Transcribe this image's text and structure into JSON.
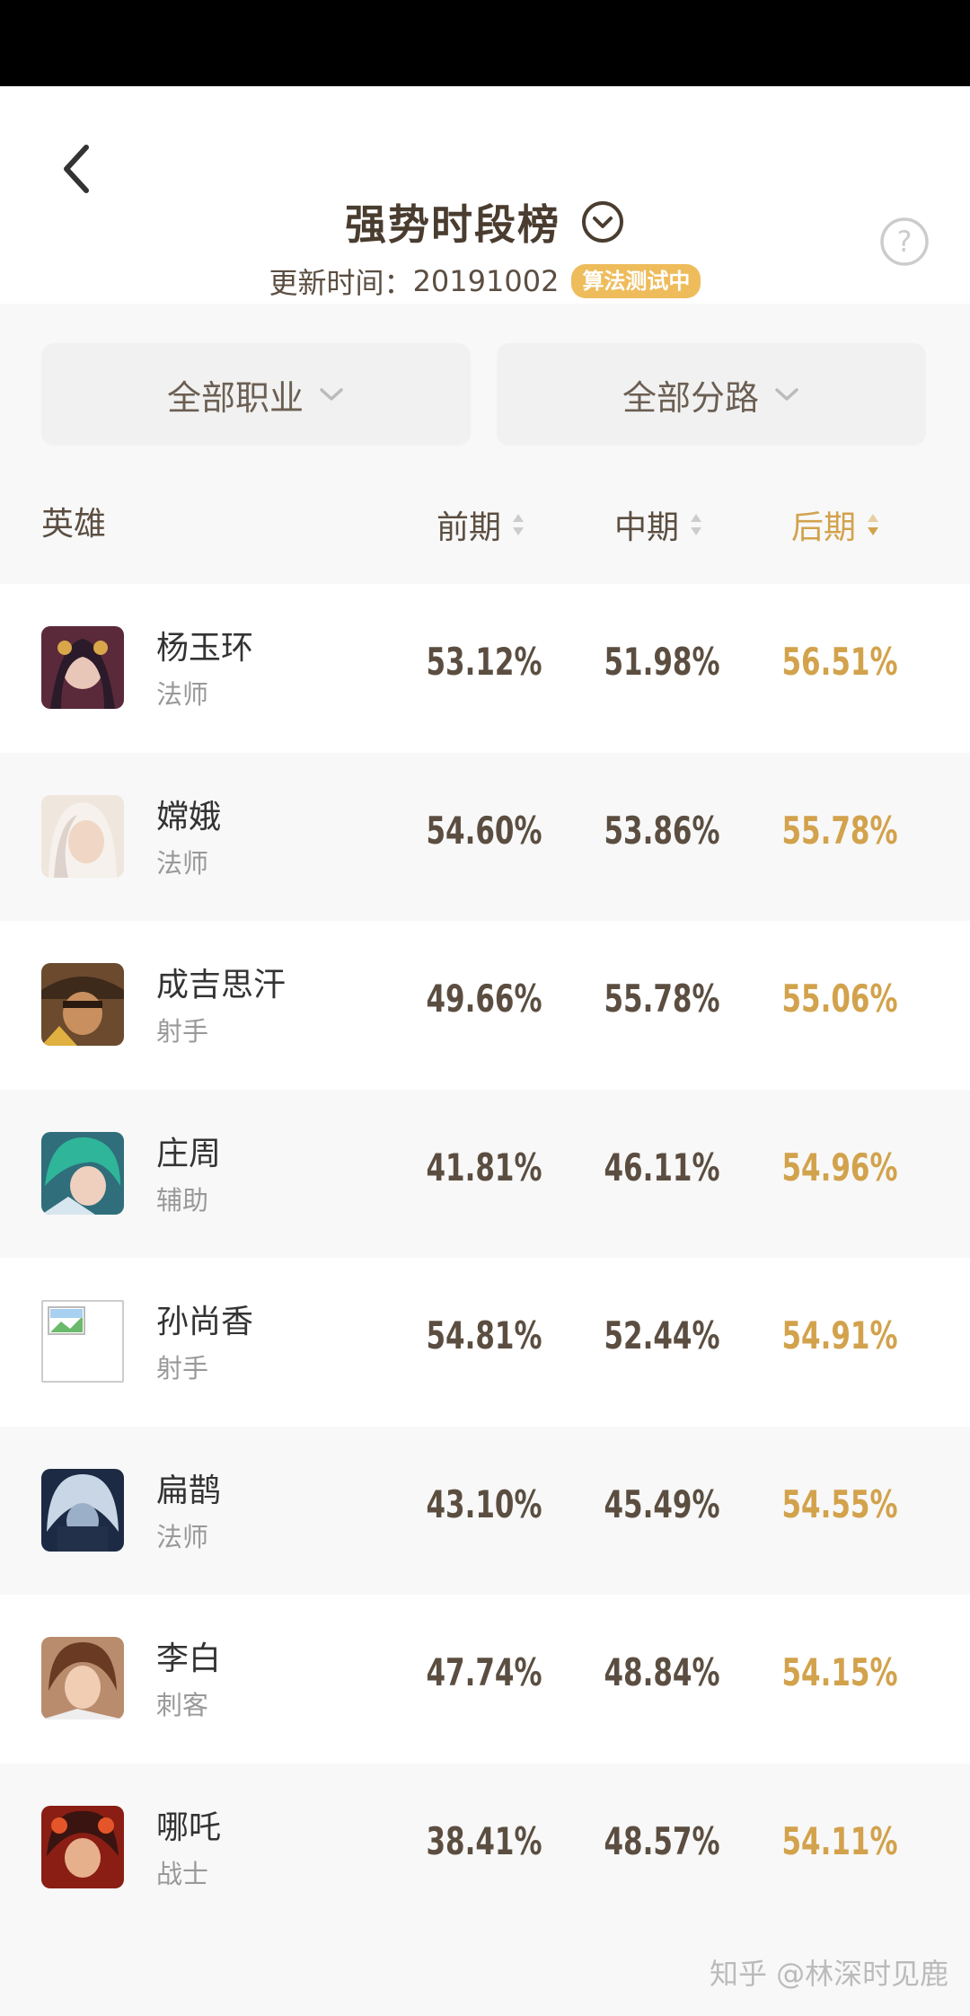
{
  "header": {
    "title": "强势时段榜",
    "update_label": "更新时间：",
    "update_date": "20191002",
    "badge": "算法测试中"
  },
  "filters": {
    "profession": "全部职业",
    "lane": "全部分路"
  },
  "columns": {
    "hero": "英雄",
    "early": "前期",
    "mid": "中期",
    "late": "后期"
  },
  "rows": [
    {
      "name": "杨玉环",
      "role": "法师",
      "early": "53.12%",
      "mid": "51.98%",
      "late": "56.51%"
    },
    {
      "name": "嫦娥",
      "role": "法师",
      "early": "54.60%",
      "mid": "53.86%",
      "late": "55.78%"
    },
    {
      "name": "成吉思汗",
      "role": "射手",
      "early": "49.66%",
      "mid": "55.78%",
      "late": "55.06%"
    },
    {
      "name": "庄周",
      "role": "辅助",
      "early": "41.81%",
      "mid": "46.11%",
      "late": "54.96%"
    },
    {
      "name": "孙尚香",
      "role": "射手",
      "early": "54.81%",
      "mid": "52.44%",
      "late": "54.91%"
    },
    {
      "name": "扁鹊",
      "role": "法师",
      "early": "43.10%",
      "mid": "45.49%",
      "late": "54.55%"
    },
    {
      "name": "李白",
      "role": "刺客",
      "early": "47.74%",
      "mid": "48.84%",
      "late": "54.15%"
    },
    {
      "name": "哪吒",
      "role": "战士",
      "early": "38.41%",
      "mid": "48.57%",
      "late": "54.11%"
    }
  ],
  "watermark": "知乎 @林深时见鹿",
  "colors": {
    "accent": "#d2a24c",
    "badge": "#eebc5b",
    "text": "#5b4e41"
  }
}
